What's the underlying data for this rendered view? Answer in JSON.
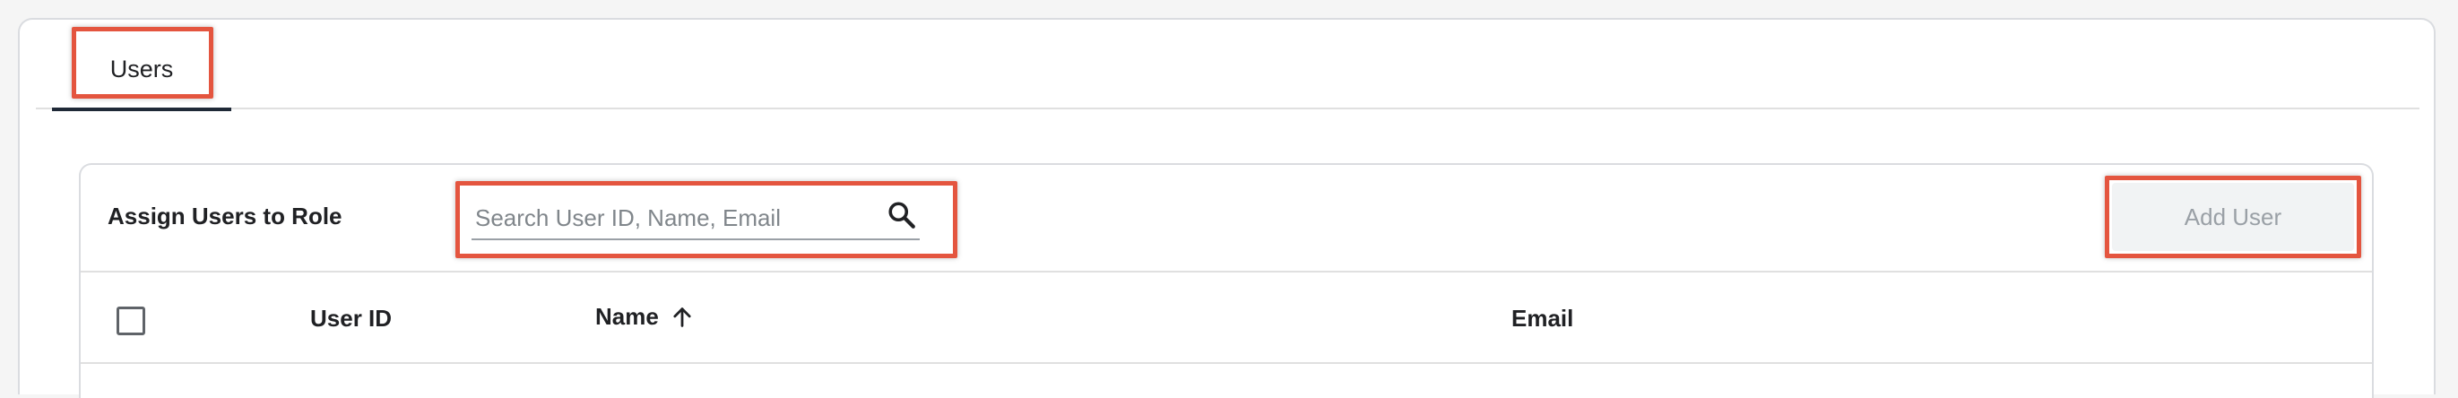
{
  "tabs": [
    {
      "label": "Users",
      "active": true
    }
  ],
  "assign_panel": {
    "title": "Assign Users to Role",
    "search": {
      "placeholder": "Search User ID, Name, Email",
      "value": "",
      "icon": "search-icon"
    },
    "add_user_label": "Add User",
    "add_user_disabled": true
  },
  "table": {
    "columns": [
      {
        "label": "User ID"
      },
      {
        "label": "Name",
        "sort": "ascending",
        "sort_icon": "arrow-up-icon"
      },
      {
        "label": "Email"
      }
    ],
    "select_all_checked": false
  },
  "colors": {
    "highlight": "#e4553f",
    "active_tab_indicator": "#1f2937",
    "disabled_button_bg": "#f1f3f4",
    "disabled_button_text": "#9aa0a6"
  }
}
